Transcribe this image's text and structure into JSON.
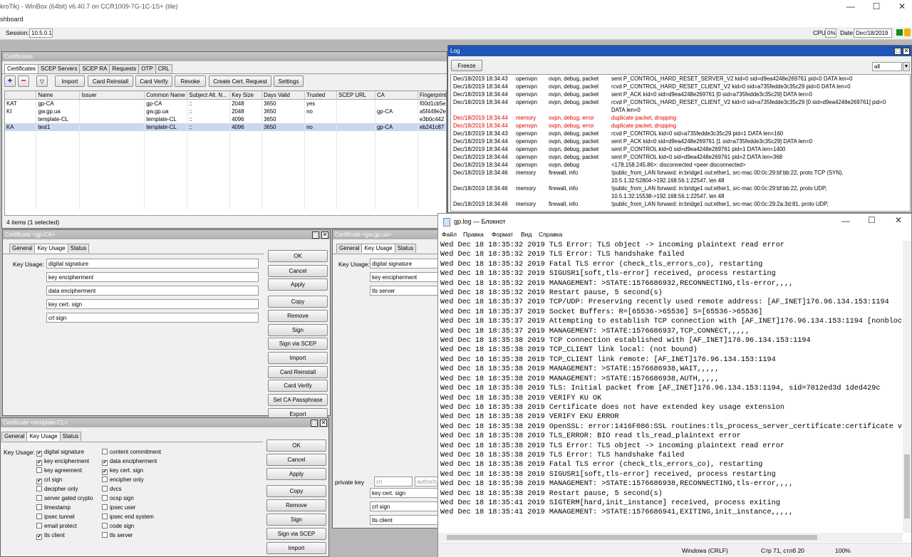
{
  "window": {
    "title": "kroTik) - WinBox (64bit) v6.40.7 on CCR1009-7G-1C-1S+ (tile)",
    "dashboard": "shboard"
  },
  "session": {
    "label": "Session:",
    "value": "10.5.0.1",
    "cpu_label": "CPU:",
    "cpu_value": "0%",
    "date_label": "Date:",
    "date_value": "Dec/18/2019"
  },
  "certs": {
    "title": "Certificates",
    "tabs": [
      "Certificates",
      "SCEP Servers",
      "SCEP RA",
      "Requests",
      "OTP",
      "CRL"
    ],
    "toolbar": [
      "Import",
      "Card Reinstall",
      "Card Verify",
      "Revoke",
      "Create Cert. Request",
      "Settings"
    ],
    "columns": [
      "",
      "Name",
      "Issuer",
      "Common Name",
      "Subject Alt. N...",
      "Key Size",
      "Days Valid",
      "Trusted",
      "SCEP URL",
      "CA",
      "Fingerprint"
    ],
    "rows": [
      [
        "KAT",
        "gp-CA",
        "",
        "gp-CA",
        "::",
        "2048",
        "3650",
        "yes",
        "",
        "",
        "f00d1cb5e"
      ],
      [
        "KI",
        "gw.gp.ua",
        "",
        "gw.gp.ua",
        "::",
        "2048",
        "3650",
        "no",
        "",
        "gp-CA",
        "a5f449e2e"
      ],
      [
        "",
        "template-CL",
        "",
        "template-CL",
        "::",
        "4096",
        "3650",
        "",
        "",
        "",
        "e3b0c442"
      ],
      [
        "KA",
        "test1",
        "",
        "template-CL",
        "::",
        "4096",
        "3650",
        "no",
        "",
        "gp-CA",
        "eb241c87"
      ]
    ],
    "status": "4 items (1 selected)"
  },
  "dlg1": {
    "title": "Certificate <gp-CA>",
    "tabs": [
      "General",
      "Key Usage",
      "Status"
    ],
    "field_label": "Key Usage:",
    "items": [
      "digital signature",
      "key encipherment",
      "data encipherment",
      "key cert. sign",
      "crl sign"
    ],
    "buttons": [
      "OK",
      "Cancel",
      "Apply",
      "Copy",
      "Remove",
      "Sign",
      "Sign via SCEP",
      "Import",
      "Card Reinstall",
      "Card Verify",
      "Set CA Passphrase",
      "Export"
    ]
  },
  "dlg2": {
    "title": "Certificate <gw.gp.ua>",
    "tabs": [
      "General",
      "Key Usage",
      "Status"
    ],
    "field_label": "Key Usage:",
    "items": [
      "digital signature",
      "key encipherment",
      "tls server"
    ],
    "private_key_label": "private key",
    "private_key_a": "crl",
    "private_key_b": "authority",
    "items_b": [
      "key cert. sign",
      "crl sign",
      "tls client"
    ]
  },
  "dlg3": {
    "title": "Certificate <template-CL>",
    "tabs": [
      "General",
      "Key Usage",
      "Status"
    ],
    "field_label": "Key Usage:",
    "left": [
      {
        "t": "digital signature",
        "c": true
      },
      {
        "t": "key encipherment",
        "c": true
      },
      {
        "t": "key agreement",
        "c": false
      },
      {
        "t": "crl sign",
        "c": true
      },
      {
        "t": "decipher only",
        "c": false
      },
      {
        "t": "server gated crypto",
        "c": false
      },
      {
        "t": "timestamp",
        "c": false
      },
      {
        "t": "ipsec tunnel",
        "c": false
      },
      {
        "t": "email protect",
        "c": false
      },
      {
        "t": "tls client",
        "c": true
      }
    ],
    "right": [
      {
        "t": "content commitment",
        "c": false
      },
      {
        "t": "data encipherment",
        "c": true
      },
      {
        "t": "key cert. sign",
        "c": true
      },
      {
        "t": "encipher only",
        "c": false
      },
      {
        "t": "dvcs",
        "c": false
      },
      {
        "t": "ocsp sign",
        "c": false
      },
      {
        "t": "ipsec user",
        "c": false
      },
      {
        "t": "ipsec end system",
        "c": false
      },
      {
        "t": "code sign",
        "c": false
      },
      {
        "t": "tls server",
        "c": false
      }
    ],
    "buttons": [
      "OK",
      "Cancel",
      "Apply",
      "Copy",
      "Remove",
      "Sign",
      "Sign via SCEP",
      "Import"
    ]
  },
  "log": {
    "title": "Log",
    "freeze": "Freeze",
    "filter": "all",
    "rows": [
      {
        "time": "Dec/18/2019 18:34:43",
        "src": "openvpn",
        "topic": "ovpn, debug, packet",
        "msg": "sent P_CONTROL_HARD_RESET_SERVER_V2 kid=0 sid=d9ea4248e269761 pid=0 DATA len=0",
        "err": false
      },
      {
        "time": "Dec/18/2019 18:34:44",
        "src": "openvpn",
        "topic": "ovpn, debug, packet",
        "msg": "rcvd P_CONTROL_HARD_RESET_CLIENT_V2 kid=0 sid=a735fedde3c35c29 pid=0 DATA len=0",
        "err": false
      },
      {
        "time": "Dec/18/2019 18:34:44",
        "src": "openvpn",
        "topic": "ovpn, debug, packet",
        "msg": "sent P_ACK kid=0 sid=d9ea4248e269761 [0 sid=a735fedde3c35c29] DATA len=0",
        "err": false
      },
      {
        "time": "Dec/18/2019 18:34:44",
        "src": "openvpn",
        "topic": "ovpn, debug, packet",
        "msg": "rcvd P_CONTROL_HARD_RESET_CLIENT_V2 kid=0 sid=a735fedde3c35c29 [0 sid=d9ea4248e269761] pid=0",
        "msg2": "DATA len=0",
        "err": false
      },
      {
        "time": "Dec/18/2019 18:34:44",
        "src": "memory",
        "topic": "ovpn, debug, error",
        "msg": "duplicate packet, dropping",
        "err": true
      },
      {
        "time": "Dec/18/2019 18:34:44",
        "src": "openvpn",
        "topic": "ovpn, debug, error",
        "msg": "duplicate packet, dropping",
        "err": true
      },
      {
        "time": "Dec/18/2019 18:34:43",
        "src": "openvpn",
        "topic": "ovpn, debug, packet",
        "msg": "rcvd P_CONTROL kid=0 sid=a735fedde3c35c29 pid=1 DATA len=160",
        "err": false
      },
      {
        "time": "Dec/18/2019 18:34:44",
        "src": "openvpn",
        "topic": "ovpn, debug, packet",
        "msg": "sent P_ACK kid=0 sid=d9ea4248e269761 [1 sid=a735fedde3c35c29] DATA len=0",
        "err": false
      },
      {
        "time": "Dec/18/2019 18:34:44",
        "src": "openvpn",
        "topic": "ovpn, debug, packet",
        "msg": "sent P_CONTROL kid=0 sid=d9ea4248e269761 pid=1 DATA len=1400",
        "err": false
      },
      {
        "time": "Dec/18/2019 18:34:44",
        "src": "openvpn",
        "topic": "ovpn, debug, packet",
        "msg": "sent P_CONTROL kid=0 sid=d9ea4248e269761 pid=2 DATA len=368",
        "err": false
      },
      {
        "time": "Dec/18/2019 18:34:44",
        "src": "openvpn",
        "topic": "ovpn, debug",
        "msg": "<178.158.245.86>: disconnected <peer disconnected>",
        "err": false
      },
      {
        "time": "Dec/18/2019 18:34:46",
        "src": "memory",
        "topic": "firewall, info",
        "msg": "!public_from_LAN forward: in:bridge1 out:ether1, src-mac 00:0c:29:bf:bb:22, proto TCP (SYN),",
        "msg2": "10.5.1.32:52804->192.168.56.1:22547, len 48",
        "err": false
      },
      {
        "time": "Dec/18/2019 18:34:46",
        "src": "memory",
        "topic": "firewall, info",
        "msg": "!public_from_LAN forward: in:bridge1 out:ether1, src-mac 00:0c:29:bf:bb:22, proto UDP,",
        "msg2": "10.5.1.32:15538->192.168.56.1:22547, len 48",
        "err": false
      },
      {
        "time": "Dec/18/2019 18:34:46",
        "src": "memory",
        "topic": "firewall, info",
        "msg": "!public_from_LAN forward: in:bridge1 out:ether1, src-mac 00:0c:29:2a:3d:81, proto UDP,",
        "err": false
      }
    ]
  },
  "notepad": {
    "title": "gp.log — Блокнот",
    "menu": [
      "Файл",
      "Правка",
      "Формат",
      "Вид",
      "Справка"
    ],
    "lines": [
      "Wed Dec 18 18:35:32 2019 TLS Error: TLS object -> incoming plaintext read error",
      "Wed Dec 18 18:35:32 2019 TLS Error: TLS handshake failed",
      "Wed Dec 18 18:35:32 2019 Fatal TLS error (check_tls_errors_co), restarting",
      "Wed Dec 18 18:35:32 2019 SIGUSR1[soft,tls-error] received, process restarting",
      "Wed Dec 18 18:35:32 2019 MANAGEMENT: >STATE:1576686932,RECONNECTING,tls-error,,,,",
      "Wed Dec 18 18:35:32 2019 Restart pause, 5 second(s)",
      "Wed Dec 18 18:35:37 2019 TCP/UDP: Preserving recently used remote address: [AF_INET]176.96.134.153:1194",
      "Wed Dec 18 18:35:37 2019 Socket Buffers: R=[65536->65536] S=[65536->65536]",
      "Wed Dec 18 18:35:37 2019 Attempting to establish TCP connection with [AF_INET]176.96.134.153:1194 [nonblock",
      "Wed Dec 18 18:35:37 2019 MANAGEMENT: >STATE:1576686937,TCP_CONNECT,,,,,",
      "Wed Dec 18 18:35:38 2019 TCP connection established with [AF_INET]176.96.134.153:1194",
      "Wed Dec 18 18:35:38 2019 TCP_CLIENT link local: (not bound)",
      "Wed Dec 18 18:35:38 2019 TCP_CLIENT link remote: [AF_INET]176.96.134.153:1194",
      "Wed Dec 18 18:35:38 2019 MANAGEMENT: >STATE:1576686938,WAIT,,,,,",
      "Wed Dec 18 18:35:38 2019 MANAGEMENT: >STATE:1576686938,AUTH,,,,,",
      "Wed Dec 18 18:35:38 2019 TLS: Initial packet from [AF_INET]176.96.134.153:1194, sid=7012ed3d 1ded429c",
      "Wed Dec 18 18:35:38 2019 VERIFY KU OK",
      "Wed Dec 18 18:35:38 2019 Certificate does not have extended key usage extension",
      "Wed Dec 18 18:35:38 2019 VERIFY EKU ERROR",
      "Wed Dec 18 18:35:38 2019 OpenSSL: error:1416F086:SSL routines:tls_process_server_certificate:certificate ve",
      "Wed Dec 18 18:35:38 2019 TLS_ERROR: BIO read tls_read_plaintext error",
      "Wed Dec 18 18:35:38 2019 TLS Error: TLS object -> incoming plaintext read error",
      "Wed Dec 18 18:35:38 2019 TLS Error: TLS handshake failed",
      "Wed Dec 18 18:35:38 2019 Fatal TLS error (check_tls_errors_co), restarting",
      "Wed Dec 18 18:35:38 2019 SIGUSR1[soft,tls-error] received, process restarting",
      "Wed Dec 18 18:35:38 2019 MANAGEMENT: >STATE:1576686938,RECONNECTING,tls-error,,,,",
      "Wed Dec 18 18:35:38 2019 Restart pause, 5 second(s)",
      "Wed Dec 18 18:35:41 2019 SIGTERM[hard,init_instance] received, process exiting",
      "Wed Dec 18 18:35:41 2019 MANAGEMENT: >STATE:1576686941,EXITING,init_instance,,,,,"
    ],
    "status": {
      "eol": "Windows (CRLF)",
      "pos": "Стр 71, стлб 20",
      "zoom": "100%"
    }
  }
}
